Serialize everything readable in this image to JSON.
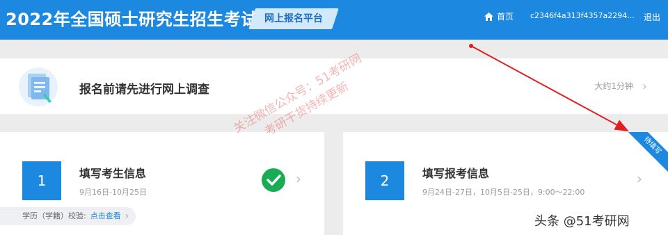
{
  "header": {
    "title": "2022年全国硕士研究生招生考试",
    "platform": "网上报名平台",
    "home_label": "首页",
    "user_id": "c2346f4a313f4357a2294...",
    "logout_label": "退出"
  },
  "survey": {
    "title": "报名前请先进行网上调查",
    "time_estimate": "大约1分钟"
  },
  "steps": [
    {
      "number": "1",
      "title": "填写考生信息",
      "date_range": "9月16日-10月25日",
      "completed": true,
      "edu_check_label": "学历（学籍）校验:",
      "edu_check_link": "点击查看"
    },
    {
      "number": "2",
      "title": "填写报考信息",
      "date_range": "9月24日-27日，10月5日-25日，9:00～22:00",
      "status_ribbon": "待填写"
    }
  ],
  "watermark": {
    "line1": "关注微信公众号：51考研网",
    "line2": "考研干货持续更新"
  },
  "footer_tag": "头条 @51考研网",
  "colors": {
    "primary": "#1d88e0",
    "check": "#1aab55",
    "arrow": "#e02020"
  }
}
